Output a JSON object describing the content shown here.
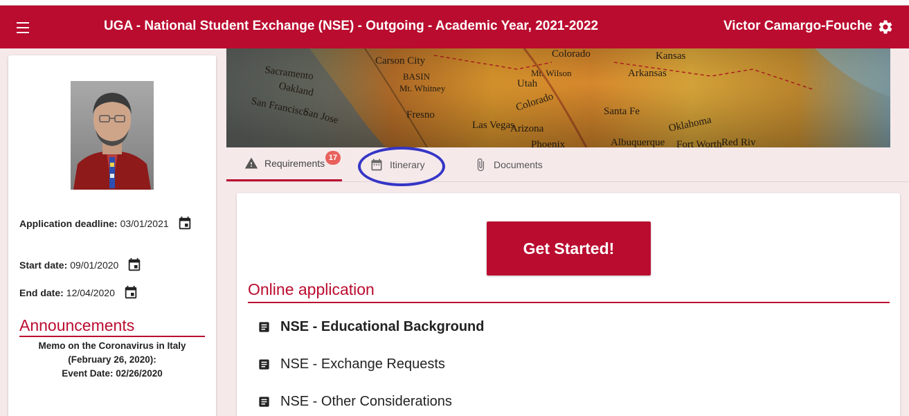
{
  "header": {
    "title": "UGA - National Student Exchange (NSE) - Outgoing - Academic Year, 2021-2022",
    "user_name": "Victor Camargo-Fouche",
    "menu_icon": "menu-icon",
    "settings_icon": "gear-icon"
  },
  "sidebar": {
    "dates": [
      {
        "label": "Application deadline:",
        "value": "03/01/2021"
      },
      {
        "label": "Start date:",
        "value": "09/01/2020"
      },
      {
        "label": "End date:",
        "value": "12/04/2020"
      }
    ],
    "announcements": {
      "title": "Announcements",
      "lines": [
        "Memo on the Coronavirus in Italy",
        "(February 26, 2020):",
        "Event Date: 02/26/2020"
      ]
    }
  },
  "banner": {
    "map_labels": [
      "Sacramento",
      "Carson City",
      "Oakland",
      "San Francisco",
      "San Jose",
      "Fresno",
      "BASIN",
      "Mt. Whitney",
      "Las Vegas",
      "Utah",
      "Mt. Wilson",
      "Colorado",
      "Arizona",
      "Santa Fe",
      "Albuquerque",
      "Kansas",
      "Arkansas",
      "Oklahoma",
      "Phoenix",
      "Fort Worth",
      "Red Riv"
    ]
  },
  "tabs": [
    {
      "label": "Requirements",
      "icon": "warning-icon",
      "badge": "17",
      "active": true
    },
    {
      "label": "Itinerary",
      "icon": "calendar-icon",
      "active": false
    },
    {
      "label": "Documents",
      "icon": "paperclip-icon",
      "active": false
    }
  ],
  "main": {
    "get_started_label": "Get Started!",
    "section_title": "Online application",
    "items": [
      {
        "label": "NSE - Educational Background",
        "bold": true
      },
      {
        "label": "NSE - Exchange Requests",
        "bold": false
      },
      {
        "label": "NSE - Other Considerations",
        "bold": false
      }
    ]
  },
  "colors": {
    "brand": "#ba0c2f",
    "badge": "#e8615c",
    "highlight_circle": "#3535c6"
  }
}
